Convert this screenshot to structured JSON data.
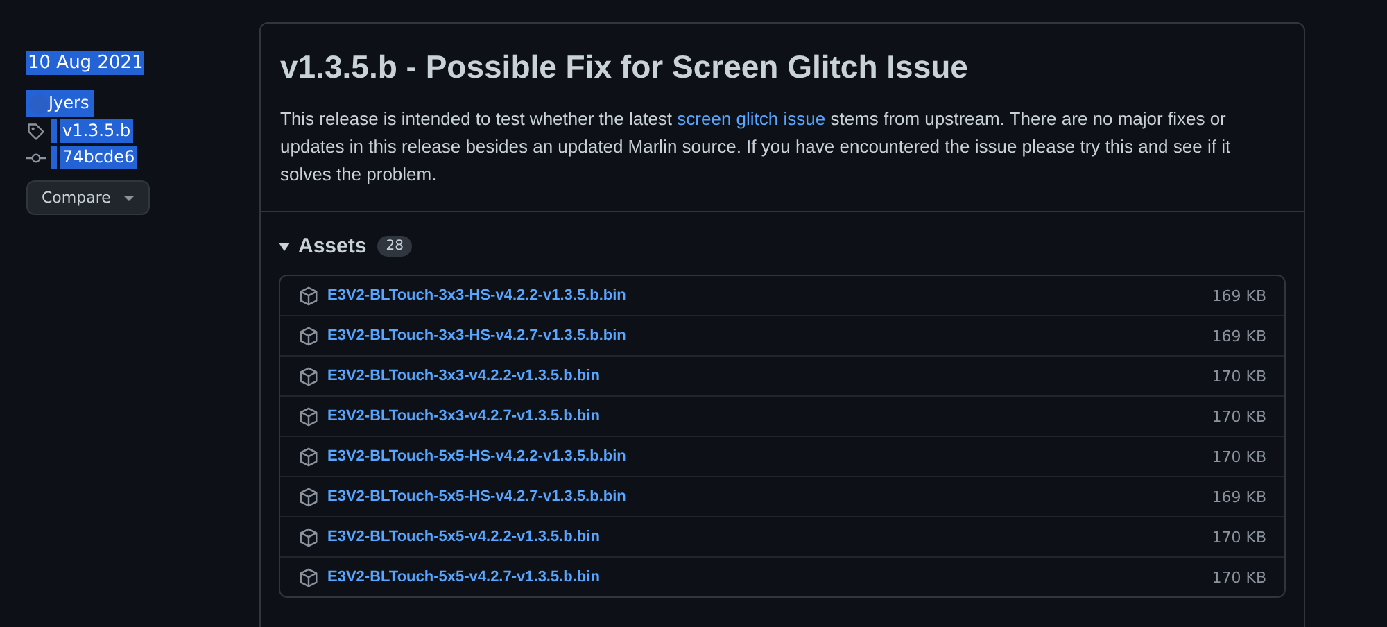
{
  "sidebar": {
    "text_selected": true,
    "date": "10 Aug 2021",
    "author": "Jyers",
    "tag": "v1.3.5.b",
    "commit": "74bcde6",
    "compare_button": "Compare"
  },
  "release": {
    "title": "v1.3.5.b - Possible Fix for Screen Glitch Issue",
    "description": [
      {
        "text": "This release is intended to test whether the latest "
      },
      {
        "text": "screen glitch issue",
        "kind": "link"
      },
      {
        "text": " stems from upstream. There are no major fixes or updates in this release besides an updated Marlin source. If you have encountered the issue please try this and see if it solves the problem."
      }
    ],
    "assets": {
      "label": "Assets",
      "count": "28",
      "expanded": true,
      "files": [
        {
          "name": "E3V2-BLTouch-3x3-HS-v4.2.2-v1.3.5.b.bin",
          "size": "169 KB"
        },
        {
          "name": "E3V2-BLTouch-3x3-HS-v4.2.7-v1.3.5.b.bin",
          "size": "169 KB"
        },
        {
          "name": "E3V2-BLTouch-3x3-v4.2.2-v1.3.5.b.bin",
          "size": "170 KB"
        },
        {
          "name": "E3V2-BLTouch-3x3-v4.2.7-v1.3.5.b.bin",
          "size": "170 KB"
        },
        {
          "name": "E3V2-BLTouch-5x5-HS-v4.2.2-v1.3.5.b.bin",
          "size": "170 KB"
        },
        {
          "name": "E3V2-BLTouch-5x5-HS-v4.2.7-v1.3.5.b.bin",
          "size": "169 KB"
        },
        {
          "name": "E3V2-BLTouch-5x5-v4.2.2-v1.3.5.b.bin",
          "size": "170 KB"
        },
        {
          "name": "E3V2-BLTouch-5x5-v4.2.7-v1.3.5.b.bin",
          "size": "170 KB"
        }
      ]
    }
  }
}
